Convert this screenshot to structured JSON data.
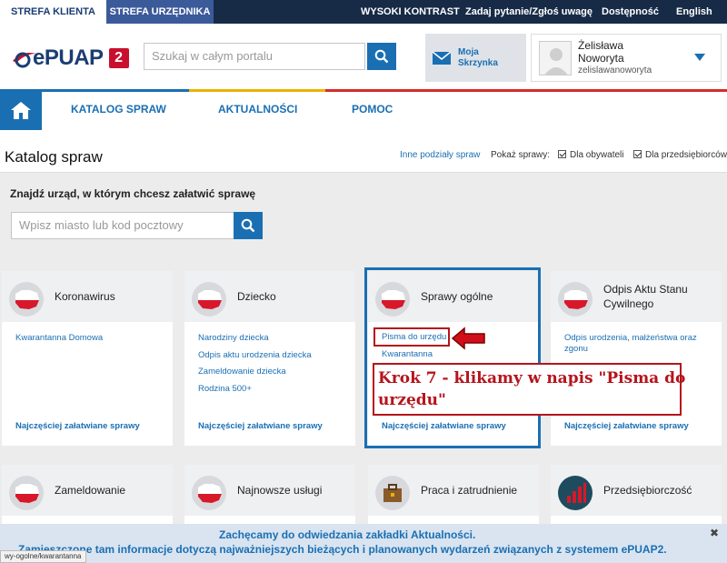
{
  "topbar": {
    "strefa_klienta": "STREFA KLIENTA",
    "strefa_urzednika": "STREFA URZĘDNIKA",
    "links": [
      "WYSOKI KONTRAST",
      "Zadaj pytanie/Zgłoś uwagę",
      "Dostępność",
      "English"
    ],
    "colors": {
      "bar": "#172b47",
      "active_tab": "#ffffff",
      "second_tab": "#3b5a9a"
    }
  },
  "header": {
    "logo_text": "ePUAP",
    "logo_badge": "2",
    "search_placeholder": "Szukaj w całym portalu",
    "inbox_line1": "Moja",
    "inbox_line2": "Skrzynka",
    "user_first": "Żelisława",
    "user_last": "Noworyta",
    "user_login": "zelislawanoworyta",
    "icons": [
      "search-icon",
      "mail-icon",
      "avatar-icon",
      "caret-down-icon"
    ]
  },
  "nav": {
    "items": [
      "KATALOG SPRAW",
      "AKTUALNOŚCI",
      "POMOC"
    ],
    "home_icon": "home-icon",
    "accent": "#1a6fb3"
  },
  "page": {
    "title": "Katalog spraw",
    "other_divisions": "Inne podziały spraw",
    "show_label": "Pokaż sprawy:",
    "filter_citizens": "Dla obywateli",
    "filter_business": "Dla przedsiębiorców"
  },
  "find": {
    "label": "Znajdź urząd, w którym chcesz załatwić sprawę",
    "placeholder": "Wpisz miasto lub kod pocztowy"
  },
  "cards": [
    {
      "title": "Koronawirus",
      "links": [
        "Kwarantanna Domowa"
      ],
      "more": "Najczęściej załatwiane sprawy"
    },
    {
      "title": "Dziecko",
      "links": [
        "Narodziny dziecka",
        "Odpis aktu urodzenia dziecka",
        "Zameldowanie dziecka",
        "Rodzina 500+"
      ],
      "more": "Najczęściej załatwiane sprawy"
    },
    {
      "title": "Sprawy ogólne",
      "links": [
        "Pisma do urzędu",
        "Kwarantanna"
      ],
      "more": "Najczęściej załatwiane sprawy"
    },
    {
      "title_line1": "Odpis Aktu Stanu",
      "title_line2": "Cywilnego",
      "links_line1": "Odpis urodzenia, małżeństwa oraz",
      "links_line2": "zgonu",
      "more": "Najczęściej załatwiane sprawy"
    },
    {
      "title": "Zameldowanie"
    },
    {
      "title": "Najnowsze usługi"
    },
    {
      "title": "Praca i zatrudnienie"
    },
    {
      "title": "Przedsiębiorczość"
    }
  ],
  "annotation": {
    "line1": "Krok 7 - klikamy w  napis \"Pisma do",
    "line2": "urzędu\"",
    "color": "#b5141c"
  },
  "banner": {
    "line1": "Zachęcamy do odwiedzania zakładki Aktualności.",
    "line2": "Zamieszczone tam informacje dotyczą najważniejszych bieżących i planowanych wydarzeń związanych z systemem ePUAP2.",
    "close": "✖"
  },
  "status_url": "wy-ogolne/kwarantanna"
}
